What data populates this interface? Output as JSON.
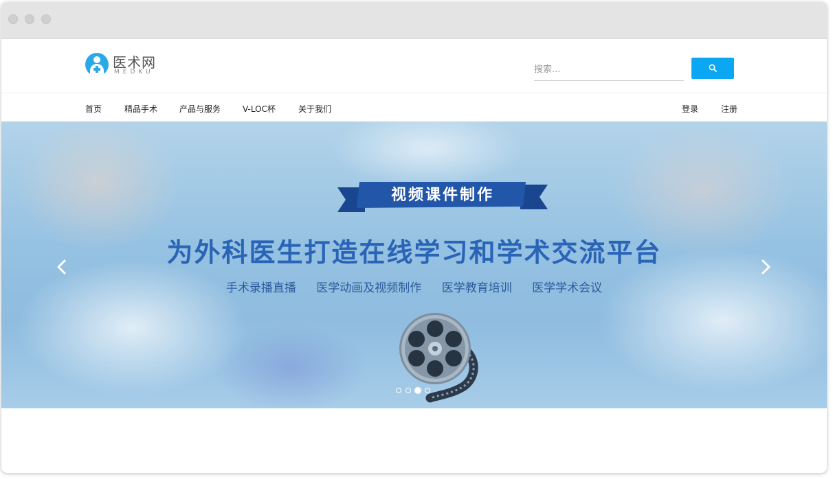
{
  "header": {
    "logo_name": "医术网",
    "logo_sub": "MEDKU",
    "search_placeholder": "搜索..."
  },
  "nav": {
    "items": [
      {
        "label": "首页"
      },
      {
        "label": "精品手术"
      },
      {
        "label": "产品与服务"
      },
      {
        "label": "V-LOC杯"
      },
      {
        "label": "关于我们"
      }
    ],
    "login": "登录",
    "register": "注册"
  },
  "banner": {
    "ribbon_title": "视频课件制作",
    "headline": "为外科医生打造在线学习和学术交流平台",
    "services": [
      "手术录播直播",
      "医学动画及视频制作",
      "医学教育培训",
      "医学学术会议"
    ],
    "slide_count": 4,
    "active_slide": 3
  },
  "colors": {
    "accent": "#0ca7f2",
    "headline": "#2a64b6",
    "ribbon": "#2256a8"
  },
  "icons": [
    "search-icon",
    "chevron-left-icon",
    "chevron-right-icon",
    "film-reel-icon",
    "logo-icon"
  ]
}
